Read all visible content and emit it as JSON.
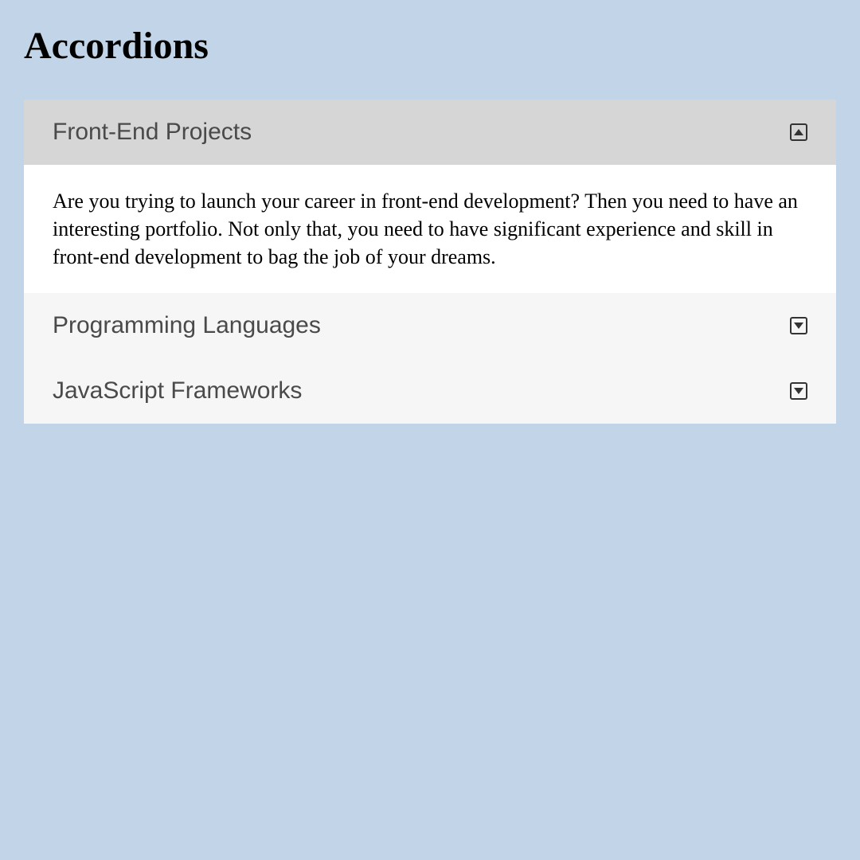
{
  "page": {
    "title": "Accordions"
  },
  "accordion": {
    "items": [
      {
        "title": "Front-End Projects",
        "content": "Are you trying to launch your career in front-end development? Then you need to have an interesting portfolio. Not only that, you need to have significant experience and skill in front-end development to bag the job of your dreams.",
        "expanded": true
      },
      {
        "title": "Programming Languages",
        "expanded": false
      },
      {
        "title": "JavaScript Frameworks",
        "expanded": false
      }
    ]
  },
  "colors": {
    "background": "#c2d5e8",
    "accordion_active": "#d6d6d6",
    "accordion_inactive": "#f6f6f6",
    "content_bg": "#ffffff"
  }
}
